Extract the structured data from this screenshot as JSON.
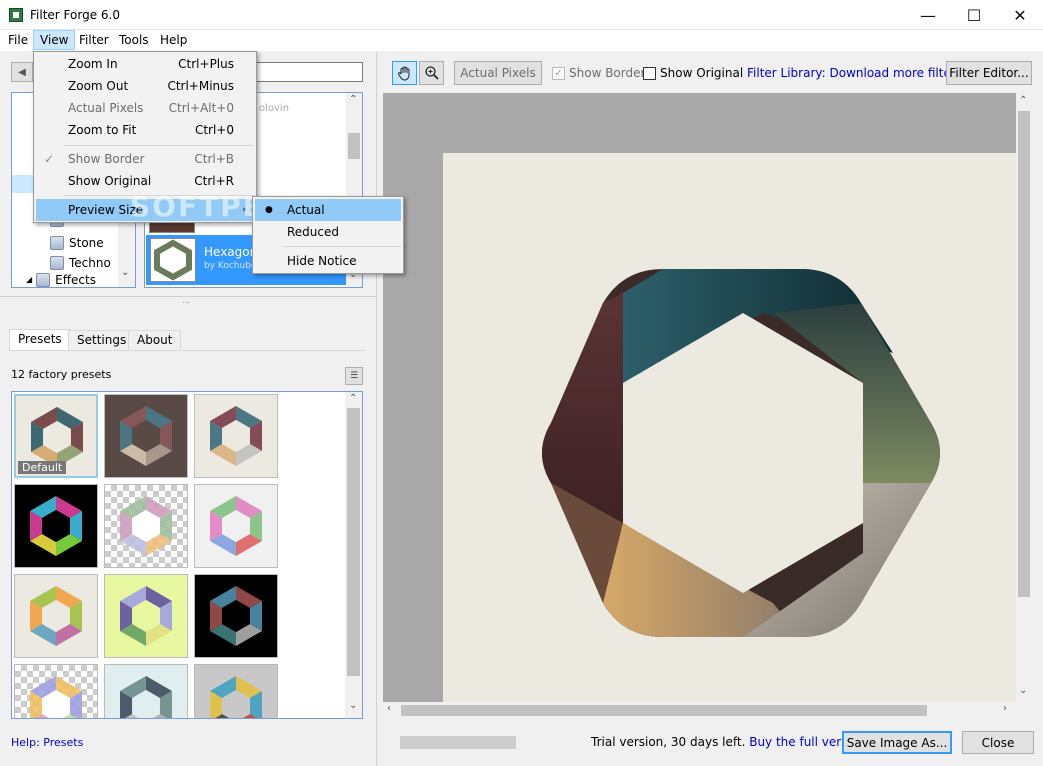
{
  "window": {
    "title": "Filter Forge 6.0",
    "minimize": "—",
    "maximize": "☐",
    "close": "✕"
  },
  "menubar": {
    "items": [
      "File",
      "View",
      "Filter",
      "Tools",
      "Help"
    ]
  },
  "view_menu": {
    "items": [
      {
        "label": "Zoom In",
        "shortcut": "Ctrl+Plus",
        "disabled": false
      },
      {
        "label": "Zoom Out",
        "shortcut": "Ctrl+Minus",
        "disabled": false
      },
      {
        "label": "Actual Pixels",
        "shortcut": "Ctrl+Alt+0",
        "disabled": true
      },
      {
        "label": "Zoom to Fit",
        "shortcut": "Ctrl+0",
        "disabled": false
      },
      {
        "label": "Show Border",
        "shortcut": "Ctrl+B",
        "disabled": true,
        "checked": true
      },
      {
        "label": "Show Original",
        "shortcut": "Ctrl+R",
        "disabled": false
      },
      {
        "label": "Preview Size",
        "shortcut": "",
        "submenu": true
      }
    ]
  },
  "preview_size_submenu": {
    "items": [
      "Actual",
      "Reduced",
      "Hide Notice"
    ],
    "selected": "Actual"
  },
  "tree": {
    "items": [
      "Stone",
      "Techno",
      "Effects"
    ],
    "partial_label": "Patterns"
  },
  "filter_list": {
    "selected_name": "Hexagon",
    "selected_author": "by Kochubey",
    "partial_author": "olovin"
  },
  "left_tabs": [
    "Presets",
    "Settings",
    "About"
  ],
  "presets": {
    "count_label": "12 factory presets",
    "default_badge": "Default",
    "items": [
      {
        "bg": "#ece9e0",
        "colors": [
          "#2b5a66",
          "#6d3a3a",
          "#8a9a6b",
          "#d4a56a"
        ]
      },
      {
        "bg": "#5a4a45",
        "colors": [
          "#4a7a8a",
          "#8a5a5a",
          "#b0a090",
          "#d8c8b0"
        ]
      },
      {
        "bg": "#ece9e0",
        "colors": [
          "#3a6a7a",
          "#7a3a4a",
          "#c0c0c0",
          "#d8b080"
        ]
      },
      {
        "bg": "#000000",
        "colors": [
          "#e040a0",
          "#40c0e0",
          "#80e040",
          "#f0e040"
        ]
      },
      {
        "bg": "checker",
        "colors": [
          "#d0a0c0",
          "#a0c0a0",
          "#f0c080",
          "#c0c0e0"
        ]
      },
      {
        "bg": "#f0f0f0",
        "colors": [
          "#e080c0",
          "#80c080",
          "#e06060",
          "#80a0e0"
        ]
      },
      {
        "bg": "#ece9e0",
        "colors": [
          "#f0a040",
          "#a0c040",
          "#c060a0",
          "#60a0c0"
        ]
      },
      {
        "bg": "#e8f8a0",
        "colors": [
          "#6050a0",
          "#a0a0e0",
          "#e0e080",
          "#60a060"
        ]
      },
      {
        "bg": "#000000",
        "colors": [
          "#a05050",
          "#5090b0",
          "#b0b0b0",
          "#408080"
        ]
      },
      {
        "bg": "checker",
        "colors": [
          "#f0c060",
          "#a0a0e0",
          "#c0e0a0",
          "#e0a0c0"
        ]
      },
      {
        "bg": "#e0eef0",
        "colors": [
          "#3a4a5a",
          "#6a8a8a",
          "#aab0a0",
          "#c0c0c0"
        ]
      },
      {
        "bg": "#c8c8c8",
        "colors": [
          "#e0c040",
          "#40a0c0",
          "#c04040",
          "#404040"
        ]
      }
    ]
  },
  "help_link": "Help: Presets",
  "toolbar": {
    "actual_pixels": "Actual Pixels",
    "show_border": "Show Border",
    "show_original": "Show Original",
    "library_prefix": "Filter Library: ",
    "library_link": "Download more filters",
    "filter_editor": "Filter Editor..."
  },
  "status": {
    "trial_text": "Trial version, 30 days left.",
    "buy_link": "Buy the full version!",
    "save_button": "Save Image As...",
    "close_button": "Close"
  },
  "watermark": "SOFTPEDIA",
  "colors": {
    "accent": "#3399ff",
    "link": "#0000cc",
    "highlight": "#91c9f7",
    "canvas": "#ece9e0"
  }
}
